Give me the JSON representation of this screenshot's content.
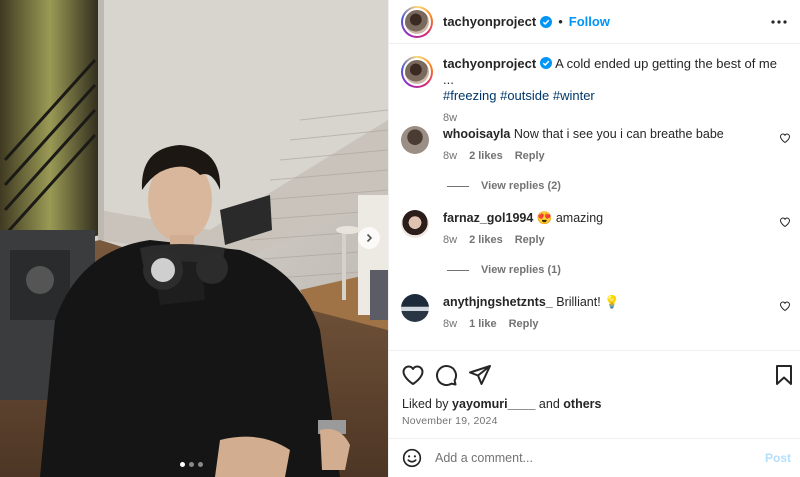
{
  "post": {
    "author": "tachyonproject",
    "follow_label": "Follow",
    "separator": "•",
    "caption_text": "A cold ended up getting the best of me ...",
    "hashtags": "#freezing #outside #winter",
    "caption_age": "8w",
    "carousel": {
      "slide_count": 3,
      "current_slide": 1
    }
  },
  "comments": [
    {
      "username": "whooisayla",
      "text": "Now that i see you i can breathe babe",
      "age": "8w",
      "likes": "2 likes",
      "reply": "Reply",
      "view_replies": "View replies (2)"
    },
    {
      "username": "farnaz_gol1994",
      "text": "😍 amazing",
      "age": "8w",
      "likes": "2 likes",
      "reply": "Reply",
      "view_replies": "View replies (1)"
    },
    {
      "username": "anythjngshetznts_",
      "text": "Brilliant! 💡",
      "age": "8w",
      "likes": "1 like",
      "reply": "Reply"
    }
  ],
  "engagement": {
    "liked_by_prefix": "Liked by",
    "liked_by_user": "yayomuri____",
    "and_label": "and",
    "others_label": "others",
    "date": "November 19, 2024"
  },
  "composer": {
    "placeholder": "Add a comment...",
    "post_label": "Post"
  },
  "icons": {
    "verified": "verified-badge-icon",
    "more": "more-options-icon",
    "like": "heart-icon",
    "comment": "comment-bubble-icon",
    "share": "paper-plane-icon",
    "save": "bookmark-icon",
    "emoji": "emoji-icon",
    "next": "chevron-right-icon"
  },
  "colors": {
    "accent": "#0095f6",
    "hashtag": "#00376b",
    "muted": "#737373",
    "post_disabled": "#b2dffc"
  }
}
